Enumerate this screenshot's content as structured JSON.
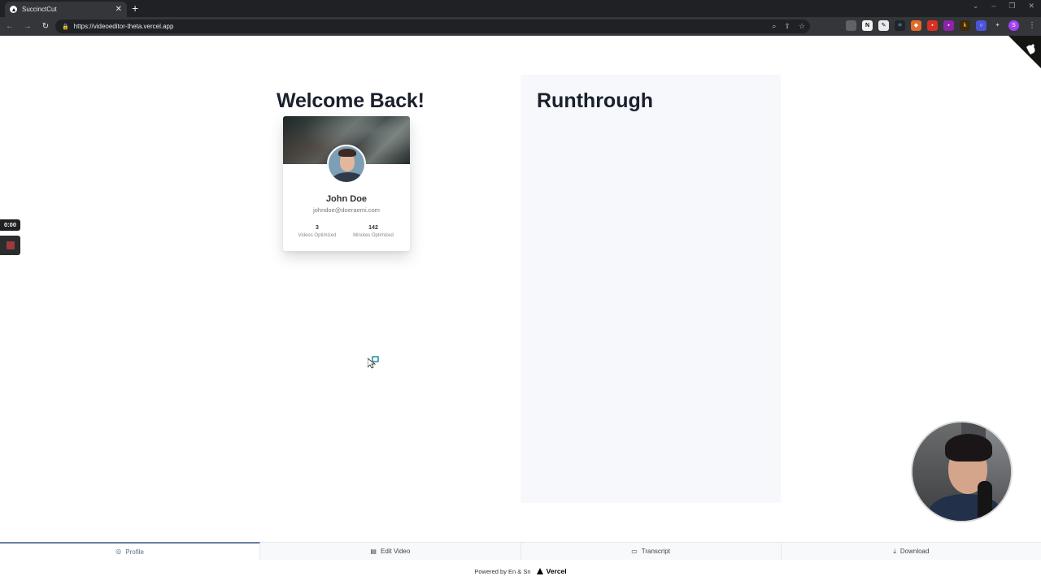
{
  "browser": {
    "tab_title": "SuccinctCut",
    "tab_close": "✕",
    "new_tab": "+",
    "url": "https://videoeditor-theta.vercel.app"
  },
  "page": {
    "welcome_heading": "Welcome Back!",
    "panel_heading": "Runthrough"
  },
  "profile": {
    "name": "John Doe",
    "email": "johndoe@doeraemi.com",
    "stats": [
      {
        "value": "3",
        "label": "Videos Optimized"
      },
      {
        "value": "142",
        "label": "Minutes Optimized"
      }
    ]
  },
  "recorder": {
    "timer": "0:00"
  },
  "tabs": [
    {
      "label": "Profile",
      "icon": "user-circle-icon",
      "active": true
    },
    {
      "label": "Edit Video",
      "icon": "film-icon",
      "active": false
    },
    {
      "label": "Transcript",
      "icon": "captions-icon",
      "active": false
    },
    {
      "label": "Download",
      "icon": "download-icon",
      "active": false
    }
  ],
  "footer": {
    "powered_text": "Powered by En & Sn",
    "brand": "Vercel"
  },
  "colors": {
    "active_tab_accent": "#6a7ea0",
    "panel_background": "#f6f8fb",
    "record_red": "#9c3a3e"
  }
}
